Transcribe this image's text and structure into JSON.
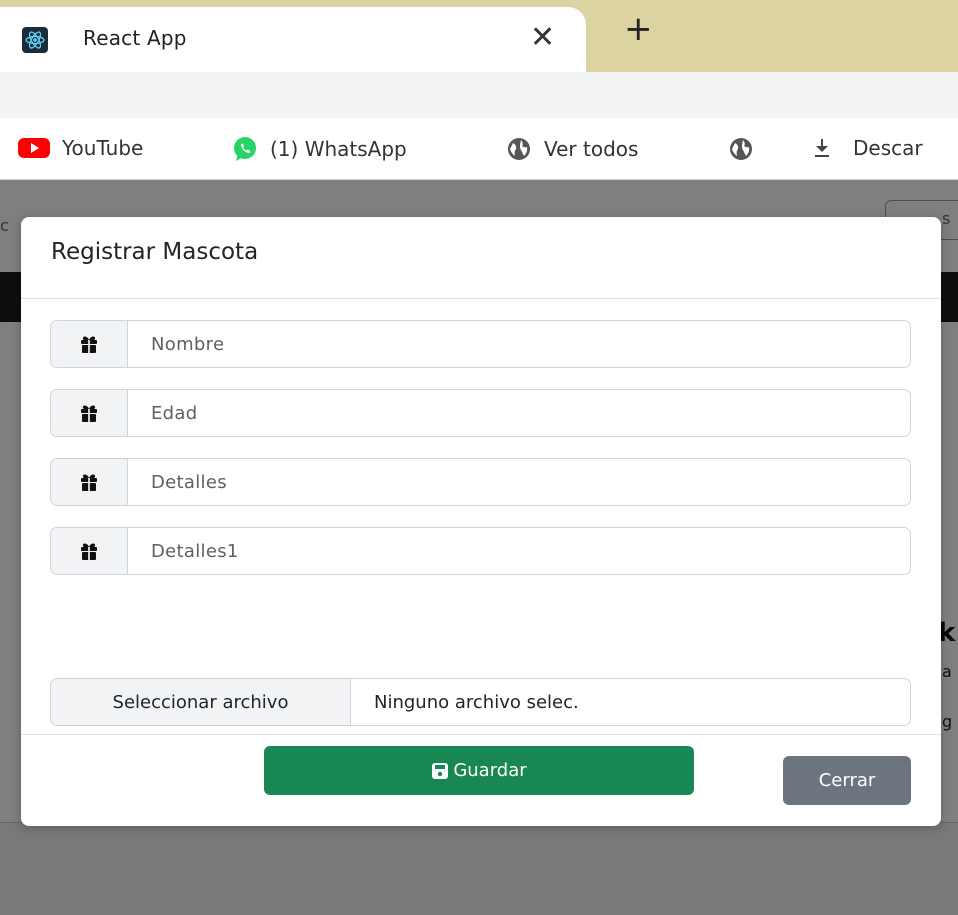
{
  "browser": {
    "tab_title": "React App",
    "tab_close_glyph": "✕",
    "new_tab_glyph": "+",
    "bookmarks": [
      {
        "label": "YouTube",
        "icon": "youtube-icon"
      },
      {
        "label": "(1) WhatsApp",
        "icon": "whatsapp-icon"
      },
      {
        "label": "Ver todos",
        "icon": "globe-icon"
      },
      {
        "label": "",
        "icon": "globe-icon"
      },
      {
        "label": "Descar",
        "icon": "download-icon"
      }
    ]
  },
  "page": {
    "search_fragment": "s",
    "left_fragment": "c",
    "heading_fragment": "k",
    "text_fragment_1": "a",
    "text_fragment_2": "g"
  },
  "modal": {
    "title": "Registrar Mascota",
    "fields": [
      {
        "placeholder": "Nombre",
        "icon": "gift-icon"
      },
      {
        "placeholder": "Edad",
        "icon": "gift-icon"
      },
      {
        "placeholder": "Detalles",
        "icon": "gift-icon"
      },
      {
        "placeholder": "Detalles1",
        "icon": "gift-icon"
      }
    ],
    "file_button_label": "Seleccionar archivo",
    "file_status": "Ninguno archivo selec.",
    "save_label": "Guardar",
    "close_label": "Cerrar"
  },
  "colors": {
    "tabstrip": "#dcd3a2",
    "success": "#198754",
    "secondary": "#6c757d",
    "youtube": "#ff0000",
    "whatsapp": "#25d366"
  }
}
